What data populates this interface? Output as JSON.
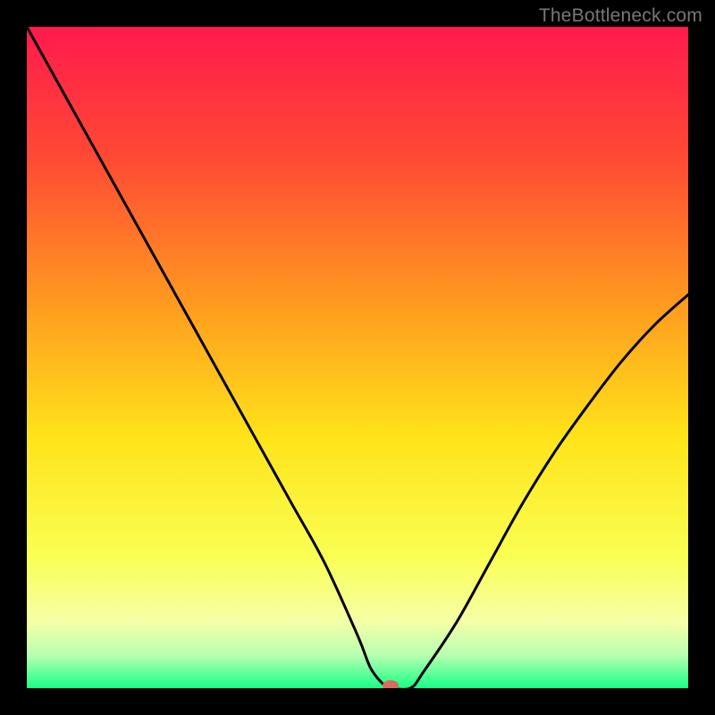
{
  "watermark": "TheBottleneck.com",
  "accent_marker_color": "#d96b5f",
  "curve_color": "#000000",
  "chart_data": {
    "type": "line",
    "title": "",
    "xlabel": "",
    "ylabel": "",
    "xlim": [
      0,
      100
    ],
    "ylim": [
      0,
      100
    ],
    "background_gradient_stops": [
      {
        "pos": 0.0,
        "color": "#ff1a4d"
      },
      {
        "pos": 0.2,
        "color": "#ff4a34"
      },
      {
        "pos": 0.42,
        "color": "#ff9b1f"
      },
      {
        "pos": 0.62,
        "color": "#ffe31a"
      },
      {
        "pos": 0.8,
        "color": "#faff52"
      },
      {
        "pos": 0.9,
        "color": "#f5ffa7"
      },
      {
        "pos": 0.95,
        "color": "#b8ffb0"
      },
      {
        "pos": 1.0,
        "color": "#18ff86"
      }
    ],
    "series": [
      {
        "name": "bottleneck_curve",
        "x": [
          0,
          5,
          10,
          15,
          20,
          25,
          30,
          35,
          40,
          45,
          50,
          52,
          54,
          55,
          58,
          60,
          65,
          70,
          75,
          80,
          85,
          90,
          95,
          100
        ],
        "y": [
          100,
          91,
          82,
          73,
          64,
          55,
          46,
          37,
          28,
          19,
          8,
          3,
          0.5,
          0,
          0,
          2.5,
          10,
          19,
          28,
          36,
          43,
          49.5,
          55,
          59.5
        ]
      }
    ],
    "marker": {
      "x": 55,
      "y": 0
    }
  }
}
